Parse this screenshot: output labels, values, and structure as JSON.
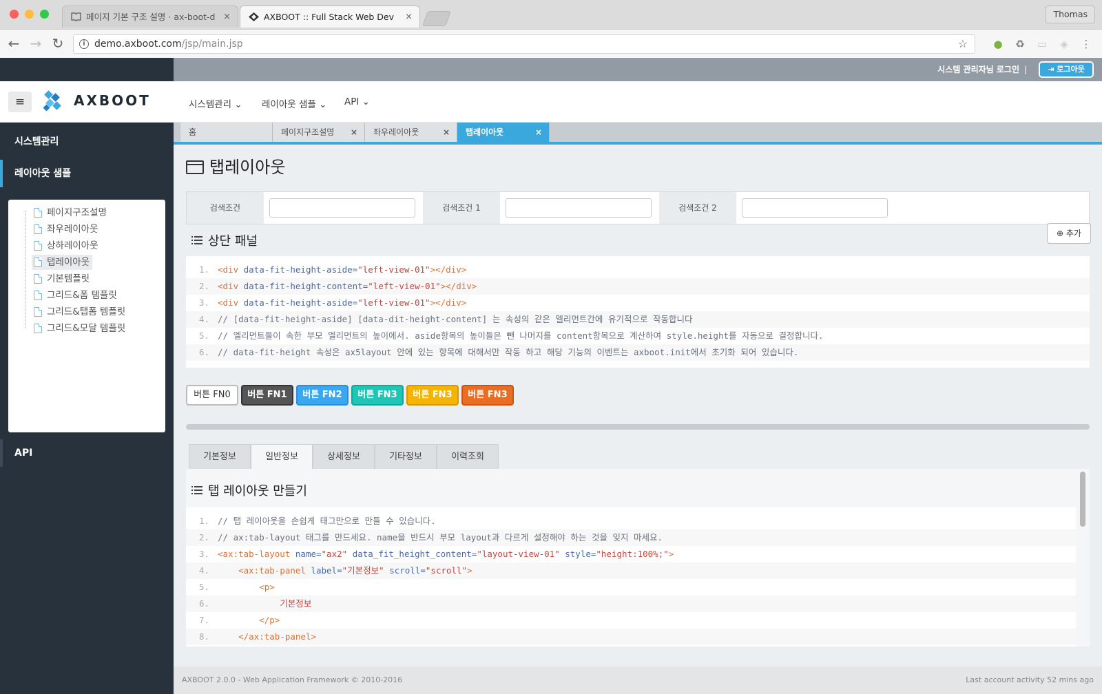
{
  "browser": {
    "tabs": [
      {
        "title": "페이지 기본 구조 설명 · ax-boot-d"
      },
      {
        "title": "AXBOOT :: Full Stack Web Dev"
      }
    ],
    "user": "Thomas",
    "url_host": "demo.axboot.com",
    "url_path": "/jsp/main.jsp"
  },
  "app": {
    "admin_text": "시스템 관리자님 로그인",
    "separator": "|",
    "logout_label": "로그아웃",
    "brand": "AXBOOT",
    "menu": [
      "시스템관리",
      "레이아웃 샘플",
      "API"
    ],
    "sidebar": {
      "items": [
        "시스템관리",
        "레이아웃 샘플",
        "API"
      ],
      "tree": [
        "페이지구조설명",
        "좌우레이아웃",
        "상하레이아웃",
        "탭레이아웃",
        "기본템플릿",
        "그리드&폼 템플릿",
        "그리드&탭폼 템플릿",
        "그리드&모달 템플릿"
      ]
    },
    "page_tabs": [
      {
        "label": "홈"
      },
      {
        "label": "페이지구조설명"
      },
      {
        "label": "좌우레이아웃"
      },
      {
        "label": "탭레이아웃"
      }
    ],
    "page_title": "탭레이아웃",
    "search": {
      "labels": [
        "검색조건",
        "검색조건 1",
        "검색조건 2"
      ]
    },
    "top_panel": {
      "title": "상단 패널",
      "add_label": "추가",
      "code": [
        [
          [
            "tag",
            "<div "
          ],
          [
            "attr",
            "data-fit-height-aside="
          ],
          [
            "str",
            "\"left-view-01\""
          ],
          [
            "tag",
            "></div>"
          ]
        ],
        [
          [
            "tag",
            "<div "
          ],
          [
            "attr",
            "data-fit-height-content="
          ],
          [
            "str",
            "\"left-view-01\""
          ],
          [
            "tag",
            "></div>"
          ]
        ],
        [
          [
            "tag",
            "<div "
          ],
          [
            "attr",
            "data-fit-height-aside="
          ],
          [
            "str",
            "\"left-view-01\""
          ],
          [
            "tag",
            "></div>"
          ]
        ],
        [
          [
            "com",
            "// [data-fit-height-aside] [data-dit-height-content] 는 속성의 같은 엘리먼트간에 유기적으로 작동합니다"
          ]
        ],
        [
          [
            "com",
            "// 엘리먼트들이 속한 부모 엘리먼트의 높이에서. aside항목의 높이들은 뺀 나머지를 content항목으로 계산하여 style.height를 자동으로 결정합니다."
          ]
        ],
        [
          [
            "com",
            "// data-fit-height 속성은 ax5layout 안에 있는 항목에 대해서만 작동 하고 해당 기능의 이벤트는 axboot.init에서 초기화 되어 있습니다."
          ]
        ]
      ]
    },
    "fn_buttons": [
      {
        "label": "버튼 FN0",
        "bg": "#ffffff",
        "border": "#bbbbbb",
        "color": "#333333"
      },
      {
        "label": "버튼 FN1",
        "bg": "#555555",
        "border": "#333333",
        "color": "#ffffff"
      },
      {
        "label": "버튼 FN2",
        "bg": "#3aa8f0",
        "border": "#2a8fd6",
        "color": "#ffffff"
      },
      {
        "label": "버튼 FN3",
        "bg": "#1fc6b5",
        "border": "#13a797",
        "color": "#ffffff"
      },
      {
        "label": "버튼 FN3",
        "bg": "#f5b400",
        "border": "#d99800",
        "color": "#ffffff"
      },
      {
        "label": "버튼 FN3",
        "bg": "#ea6d24",
        "border": "#c95514",
        "color": "#ffffff"
      }
    ],
    "bottom_tabs": [
      "기본정보",
      "일반정보",
      "상세정보",
      "기타정보",
      "이력조회"
    ],
    "tab_layout_panel": {
      "title": "탭 레이아웃 만들기",
      "code": [
        [
          [
            "com",
            "// 탭 레이아웃을 손쉽게 태그만으로 만들 수 있습니다."
          ]
        ],
        [
          [
            "com",
            "// ax:tab-layout 태그를 만드세요. name을 반드시 부모 layout과 다르게 설정해야 하는 것을 잊지 마세요."
          ]
        ],
        [
          [
            "tag",
            "<ax:tab-layout "
          ],
          [
            "attr",
            "name="
          ],
          [
            "str",
            "\"ax2\" "
          ],
          [
            "attr",
            "data_fit_height_content="
          ],
          [
            "str",
            "\"layout-view-01\" "
          ],
          [
            "attr",
            "style="
          ],
          [
            "str",
            "\"height:100%;\""
          ],
          [
            "tag",
            ">"
          ]
        ],
        [
          [
            "txt",
            "    "
          ],
          [
            "tag",
            "<ax:tab-panel "
          ],
          [
            "attr",
            "label="
          ],
          [
            "str",
            "\"기본정보\" "
          ],
          [
            "attr",
            "scroll="
          ],
          [
            "str",
            "\"scroll\""
          ],
          [
            "tag",
            ">"
          ]
        ],
        [
          [
            "txt",
            "        "
          ],
          [
            "tag",
            "<p>"
          ]
        ],
        [
          [
            "txt",
            "            "
          ],
          [
            "str",
            "기본정보"
          ]
        ],
        [
          [
            "txt",
            "        "
          ],
          [
            "tag",
            "</p>"
          ]
        ],
        [
          [
            "txt",
            "    "
          ],
          [
            "tag",
            "</ax:tab-panel>"
          ]
        ]
      ]
    },
    "footer_left": "AXBOOT 2.0.0 - Web Application Framework © 2010-2016",
    "footer_right": "Last account activity 52 mins ago"
  },
  "colors": {
    "accent": "#3aa8dd",
    "sidebar": "#27323d",
    "topbar": "#929ba4"
  }
}
